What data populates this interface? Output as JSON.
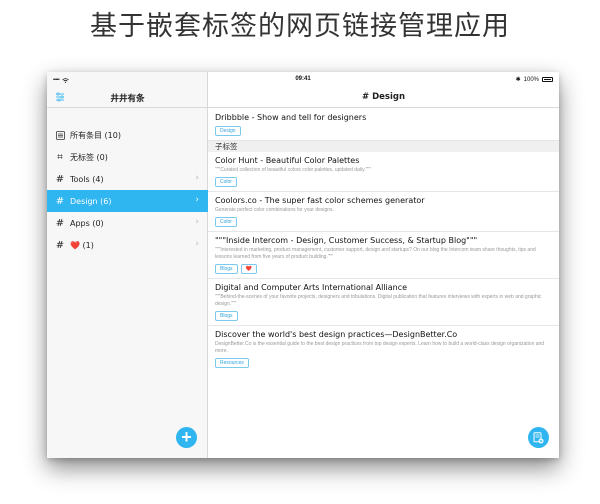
{
  "headline": "基于嵌套标签的网页链接管理应用",
  "status_bar": {
    "time": "09:41",
    "battery": "100%"
  },
  "sidebar": {
    "title": "井井有条",
    "items": [
      {
        "icon": "list-icon",
        "label": "所有条目 (10)",
        "active": false,
        "has_chevron": false
      },
      {
        "icon": "hash-icon",
        "label": "无标签 (0)",
        "active": false,
        "has_chevron": false
      },
      {
        "icon": "hash-icon",
        "label": "Tools (4)",
        "active": false,
        "has_chevron": true
      },
      {
        "icon": "hash-icon",
        "label": "Design (6)",
        "active": true,
        "has_chevron": true
      },
      {
        "icon": "hash-icon",
        "label": "Apps (0)",
        "active": false,
        "has_chevron": true
      },
      {
        "icon": "hash-icon",
        "label": "❤️ (1)",
        "active": false,
        "has_chevron": true
      }
    ],
    "add_button_icon": "plus-icon"
  },
  "main": {
    "title": "# Design",
    "links_top": [
      {
        "title": "Dribbble - Show and tell for designers",
        "description": "",
        "tags": [
          "Design"
        ]
      }
    ],
    "subtag_header": "子标签",
    "links": [
      {
        "title": "Color Hunt - Beautiful Color Palettes",
        "description": "\"\"\"Curated collection of beautiful colors color palettes, updated daily.\"\"\"",
        "tags": [
          "Color"
        ]
      },
      {
        "title": "Coolors.co - The super fast color schemes generator",
        "description": "Generate perfect color combinations for your designs.",
        "tags": [
          "Color"
        ]
      },
      {
        "title": "\"\"\"Inside Intercom - Design, Customer Success, & Startup Blog\"\"\"",
        "description": "\"\"\"Interested in marketing, product management, customer support, design and startups? On our blog the Intercom team share thoughts, tips and lessons learned from five years of product building.\"\"\"",
        "tags": [
          "Blogs",
          "❤️"
        ]
      },
      {
        "title": "Digital and Computer Arts International Alliance",
        "description": "\"\"\"Behind-the-scenes of your favorite projects, designers and tribulations. Digital publication that features interviews with experts in web and graphic design.\"\"\"",
        "tags": [
          "Blogs"
        ]
      },
      {
        "title": "Discover the world's best design practices—DesignBetter.Co",
        "description": "DesignBetter.Co is the essential guide to the best design practices from top design experts. Learn how to build a world-class design organization and more.",
        "tags": [
          "Resources"
        ]
      }
    ],
    "fab_icon": "add-document-icon"
  },
  "colors": {
    "accent": "#2fb5f0",
    "sidebar_bg": "#f7f7f7"
  }
}
